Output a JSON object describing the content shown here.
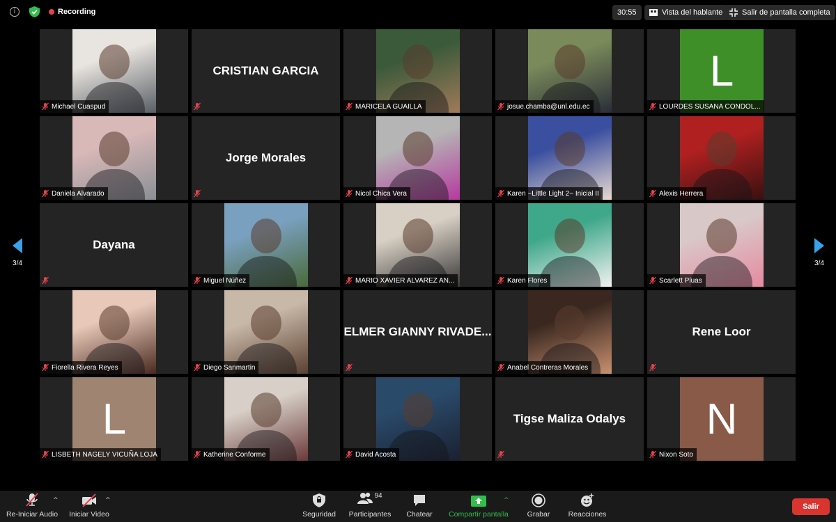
{
  "topbar": {
    "recording_label": "Recording",
    "timer": "30:55",
    "speaker_view_label": "Vista del hablante",
    "fullscreen_label": "Salir de pantalla completa"
  },
  "pagination": {
    "left": "3/4",
    "right": "3/4"
  },
  "participants": [
    {
      "name": "Michael Cuaspud",
      "type": "photo",
      "colors": [
        "#e8e4df",
        "#5a5f66"
      ]
    },
    {
      "name": "CRISTIAN GARCIA",
      "type": "text"
    },
    {
      "name": "MARICELA GUAILLA",
      "type": "photo",
      "colors": [
        "#3a5a3a",
        "#a07a5a"
      ]
    },
    {
      "name": "josue.chamba@unl.edu.ec",
      "type": "photo",
      "colors": [
        "#7a8a5a",
        "#2a2d38"
      ]
    },
    {
      "name": "LOURDES SUSANA CONDOL...",
      "type": "letter",
      "letter": "L",
      "color": "#3f8f28"
    },
    {
      "name": "Daniela Alvarado",
      "type": "photo",
      "colors": [
        "#d9b8b8",
        "#8a8f95"
      ]
    },
    {
      "name": "Jorge Morales",
      "type": "text"
    },
    {
      "name": "Nicol Chica Vera",
      "type": "photo",
      "colors": [
        "#b5b5b5",
        "#b53a9f"
      ]
    },
    {
      "name": "Karen ~Little Light 2~ Inicial II",
      "type": "photo",
      "colors": [
        "#3a4fa0",
        "#e8d9d0"
      ]
    },
    {
      "name": "Alexis Herrera",
      "type": "photo",
      "colors": [
        "#b02020",
        "#3a1010"
      ]
    },
    {
      "name": "Dayana",
      "type": "text"
    },
    {
      "name": "Miguel Núñez",
      "type": "photo",
      "colors": [
        "#7aa0c0",
        "#4a6a3a"
      ]
    },
    {
      "name": "MARIO XAVIER ALVAREZ AN...",
      "type": "photo",
      "colors": [
        "#d8d0c4",
        "#3a3838"
      ]
    },
    {
      "name": "Karen Flores",
      "type": "photo",
      "colors": [
        "#3fa88a",
        "#f2f2f2"
      ]
    },
    {
      "name": "Scarlett Pluas",
      "type": "photo",
      "colors": [
        "#d9c8c8",
        "#e58aa0"
      ]
    },
    {
      "name": "Fiorella Rivera Reyes",
      "type": "photo",
      "colors": [
        "#e8c8b8",
        "#4a2a20"
      ]
    },
    {
      "name": "Diego Sanmartin",
      "type": "photo",
      "colors": [
        "#c8b8a8",
        "#5a4030"
      ]
    },
    {
      "name": "ELMER GIANNY RIVADE...",
      "type": "text"
    },
    {
      "name": "Anabel Contreras Morales",
      "type": "photo",
      "colors": [
        "#3a2820",
        "#c89070"
      ]
    },
    {
      "name": "Rene Loor",
      "type": "text"
    },
    {
      "name": "LISBETH NAGELY VICUÑA LOJA",
      "type": "letter",
      "letter": "L",
      "color": "#a08472"
    },
    {
      "name": "Katherine Conforme",
      "type": "photo",
      "colors": [
        "#d8d0c8",
        "#6a3a3a"
      ]
    },
    {
      "name": "David Acosta",
      "type": "photo",
      "colors": [
        "#2a4a6a",
        "#1a2030"
      ]
    },
    {
      "name": "Tigse Maliza Odalys",
      "type": "text"
    },
    {
      "name": "Nixon Soto",
      "type": "letter",
      "letter": "N",
      "color": "#8a5a48"
    }
  ],
  "toolbar": {
    "audio_label": "Re-Iniciar Audio",
    "video_label": "Iniciar Video",
    "security_label": "Seguridad",
    "participants_label": "Participantes",
    "participants_count": "94",
    "chat_label": "Chatear",
    "share_label": "Compartir pantalla",
    "record_label": "Grabar",
    "reactions_label": "Reacciones",
    "leave_label": "Salir",
    "share_color": "#2fbf4a",
    "leave_color": "#d9342f"
  }
}
